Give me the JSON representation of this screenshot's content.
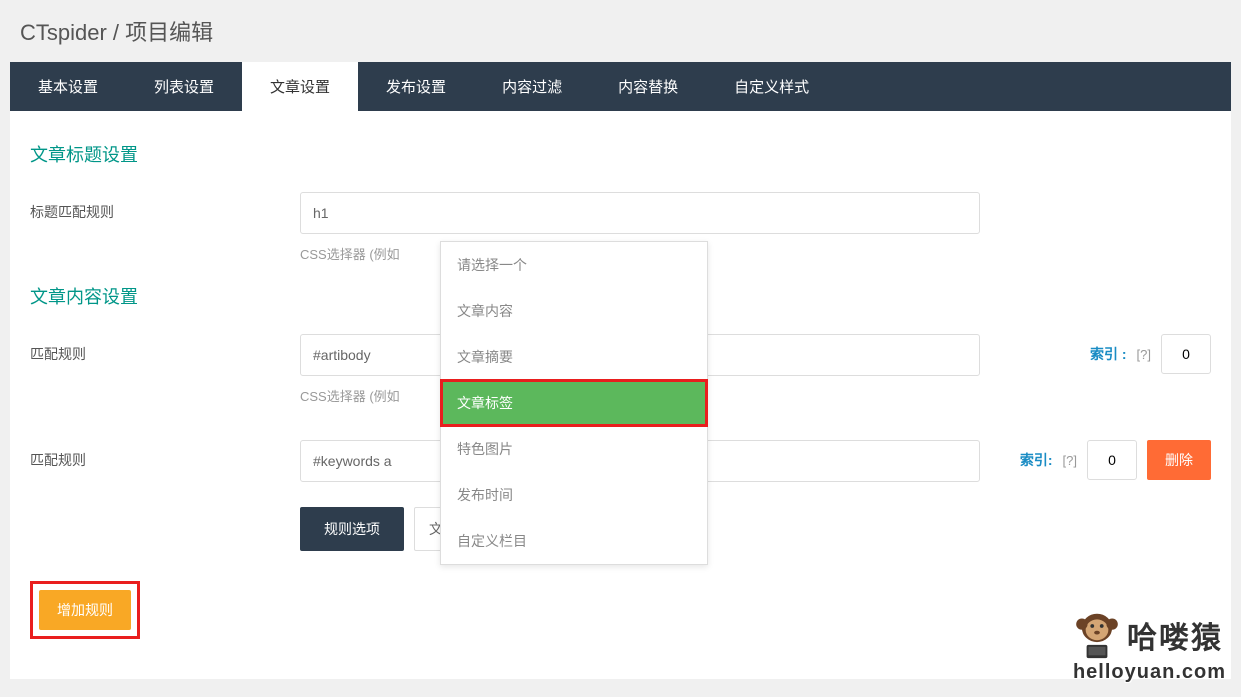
{
  "header": {
    "title": "CTspider / 项目编辑"
  },
  "tabs": [
    {
      "label": "基本设置"
    },
    {
      "label": "列表设置"
    },
    {
      "label": "文章设置"
    },
    {
      "label": "发布设置"
    },
    {
      "label": "内容过滤"
    },
    {
      "label": "内容替换"
    },
    {
      "label": "自定义样式"
    }
  ],
  "section1": {
    "title": "文章标题设置",
    "label": "标题匹配规则",
    "value": "h1",
    "help": "CSS选择器 (例如"
  },
  "section2": {
    "title": "文章内容设置",
    "row1": {
      "label": "匹配规则",
      "value": "#artibody",
      "help": "CSS选择器 (例如",
      "index_label": "索引 :",
      "help_q": "[?]",
      "index_value": "0"
    },
    "row2": {
      "label": "匹配规则",
      "value": "#keywords a",
      "index_label": "索引:",
      "help_q": "[?]",
      "index_value": "0",
      "delete_btn": "删除"
    },
    "row3": {
      "rule_options_btn": "规则选项",
      "select_value": "文章标签"
    }
  },
  "dropdown": {
    "placeholder": "请选择一个",
    "options": [
      {
        "label": "文章内容"
      },
      {
        "label": "文章摘要"
      },
      {
        "label": "文章标签",
        "selected": true
      },
      {
        "label": "特色图片"
      },
      {
        "label": "发布时间"
      },
      {
        "label": "自定义栏目"
      }
    ]
  },
  "add_rule_btn": "增加规则",
  "watermark": {
    "cn": "哈喽猿",
    "url": "helloyuan.com"
  }
}
